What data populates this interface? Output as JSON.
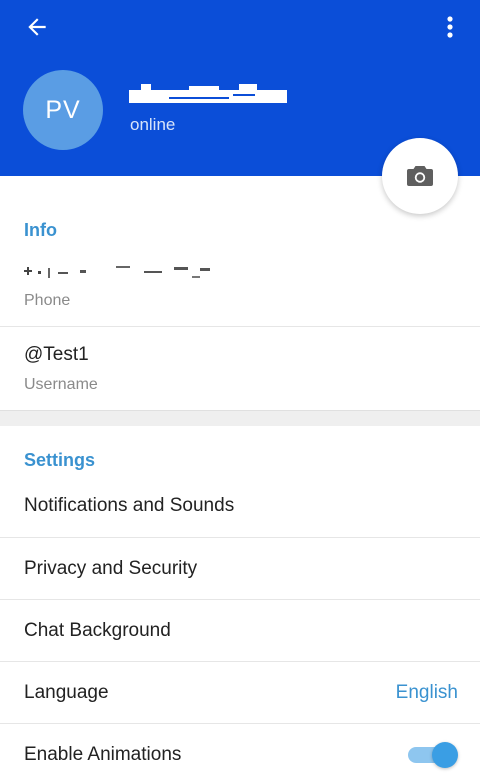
{
  "header": {
    "avatar_initials": "PV",
    "status": "online",
    "background_color": "#0b4ed8"
  },
  "icons": {
    "back": "arrow-left-icon",
    "more": "more-vert-icon",
    "camera": "camera-icon"
  },
  "info": {
    "section_title": "Info",
    "phone_label": "Phone",
    "username_value": "@Test1",
    "username_label": "Username"
  },
  "settings": {
    "section_title": "Settings",
    "items": [
      {
        "label": "Notifications and Sounds"
      },
      {
        "label": "Privacy and Security"
      },
      {
        "label": "Chat Background"
      },
      {
        "label": "Language",
        "value": "English"
      },
      {
        "label": "Enable Animations",
        "toggle_on": true
      }
    ]
  },
  "colors": {
    "accent": "#3a92d0",
    "toggle": "#3a9ee4"
  }
}
